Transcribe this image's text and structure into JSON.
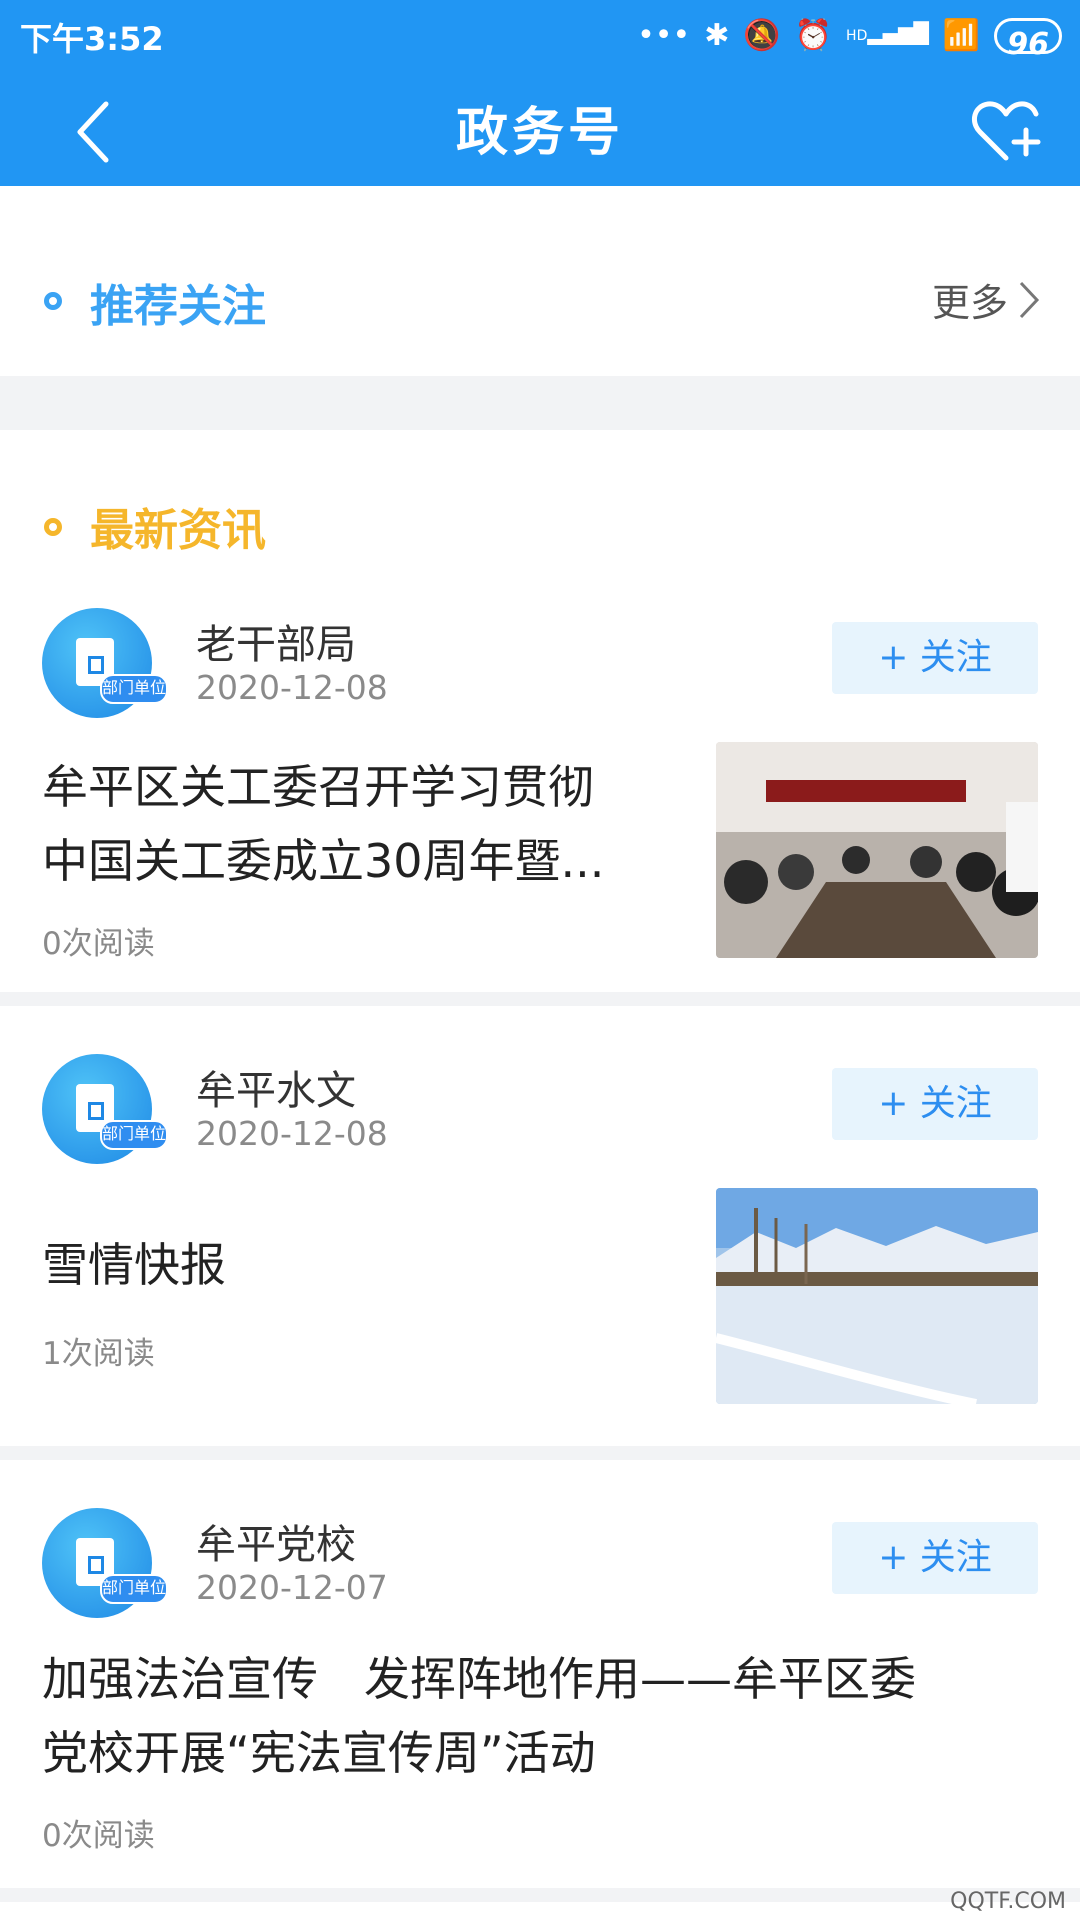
{
  "status": {
    "time": "下午3:52",
    "battery": "96",
    "icons": [
      "more-dots-icon",
      "bluetooth-icon",
      "mute-icon",
      "alarm-icon",
      "signal-icon",
      "wifi-icon",
      "battery-icon"
    ],
    "signal_badge": "HD"
  },
  "header": {
    "title": "政务号",
    "back_icon": "back-icon",
    "right_icon": "heart-plus-icon"
  },
  "recommend": {
    "title": "推荐关注",
    "more_label": "更多"
  },
  "latest": {
    "title": "最新资讯"
  },
  "news": [
    {
      "source": "老干部局",
      "date": "2020-12-08",
      "badge": "部门单位",
      "follow_label": "+ 关注",
      "title_line1": "牟平区关工委召开学习贯彻",
      "title_line2": "中国关工委成立30周年暨...",
      "reads": "0次阅读",
      "thumb": "meeting-photo"
    },
    {
      "source": "牟平水文",
      "date": "2020-12-08",
      "badge": "部门单位",
      "follow_label": "+ 关注",
      "title_line1": "雪情快报",
      "title_line2": "",
      "reads": "1次阅读",
      "thumb": "snow-photo"
    },
    {
      "source": "牟平党校",
      "date": "2020-12-07",
      "badge": "部门单位",
      "follow_label": "+ 关注",
      "title_line1": "加强法治宣传　发挥阵地作用——牟平区委",
      "title_line2": "党校开展“宪法宣传周”活动",
      "reads": "0次阅读",
      "thumb": ""
    }
  ],
  "watermark": "QQTF.COM",
  "colors": {
    "primary": "#2196f3",
    "recommend_accent": "#3aa3f4",
    "latest_accent": "#f5b62b",
    "follow_bg": "#e7f4fd"
  }
}
